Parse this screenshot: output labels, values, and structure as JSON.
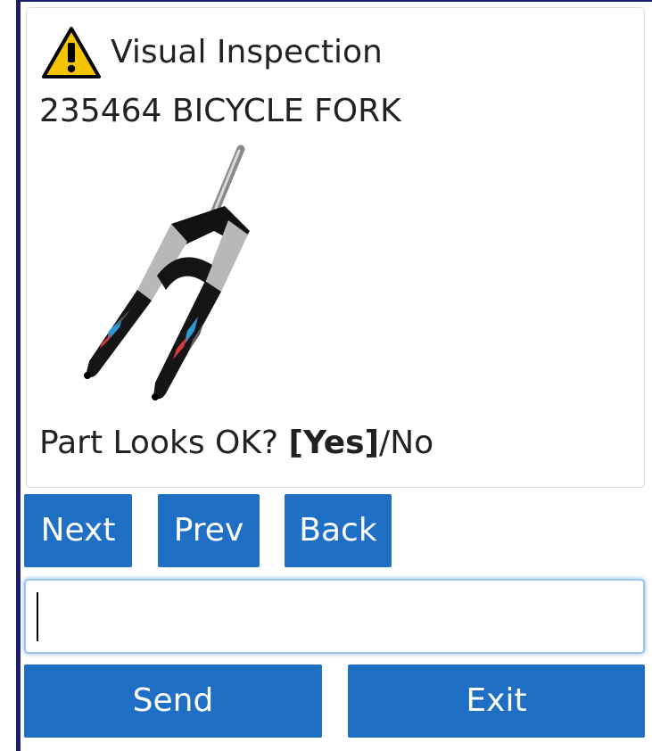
{
  "header": {
    "title": "Visual Inspection",
    "warning_icon": "warning-icon"
  },
  "part": {
    "label": "235464 BICYCLE FORK"
  },
  "question": {
    "prefix": "Part Looks OK? ",
    "default_option": "[Yes]",
    "separator": "/",
    "alternate_option": "No"
  },
  "navigation": {
    "next_label": "Next",
    "prev_label": "Prev",
    "back_label": "Back"
  },
  "input": {
    "value": "",
    "placeholder": ""
  },
  "actions": {
    "send_label": "Send",
    "exit_label": "Exit"
  },
  "colors": {
    "button": "#1f6fc4",
    "warning": "#f5c400",
    "frame_border": "#1b1f6b"
  }
}
